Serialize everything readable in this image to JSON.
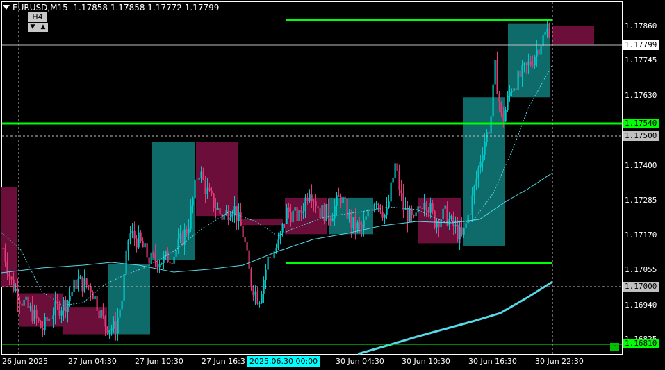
{
  "header": {
    "symbol": "EURUSD,M15",
    "ohlc": "1.17858 1.17858 1.17772 1.17799"
  },
  "timeframe": {
    "label": "H4",
    "down": "▼",
    "up": "▲"
  },
  "price_axis": {
    "ticks": [
      "1.17860",
      "1.17745",
      "1.17630",
      "1.17400",
      "1.17285",
      "1.17170",
      "1.17055",
      "1.16940",
      "1.16825"
    ],
    "tags": {
      "current": "1.17799",
      "green_level": "1.17540",
      "level_2": "1.17500",
      "level_3": "1.17000",
      "bottom_level": "1.16810"
    }
  },
  "time_axis": {
    "labels": [
      "26 Jun 2025",
      "27 Jun 04:30",
      "27 Jun 10:30",
      "27 Jun 16:3",
      "30 Jun 04:30",
      "30 Jun 10:30",
      "30 Jun 16:30",
      "30 Jun 22:30"
    ],
    "crosshair_label": "2025.06.30 00:00"
  },
  "colors": {
    "background": "#000000",
    "bull": "#00c8c8",
    "bear": "#e03a78",
    "htf_bull": "#0f6b69",
    "htf_bear": "#6b0f3a",
    "level_green": "#00ff00",
    "ma": "#55d8e8"
  },
  "chart_data": {
    "type": "candlestick",
    "symbol": "EURUSD",
    "timeframe": "M15",
    "overlay_timeframe": "H4",
    "price_range": [
      1.1679,
      1.1793
    ],
    "horizontal_levels": [
      1.1754,
      1.175,
      1.17,
      1.1681
    ],
    "box_levels": [
      1.17881,
      1.17068
    ],
    "last_price": 1.17799
  }
}
